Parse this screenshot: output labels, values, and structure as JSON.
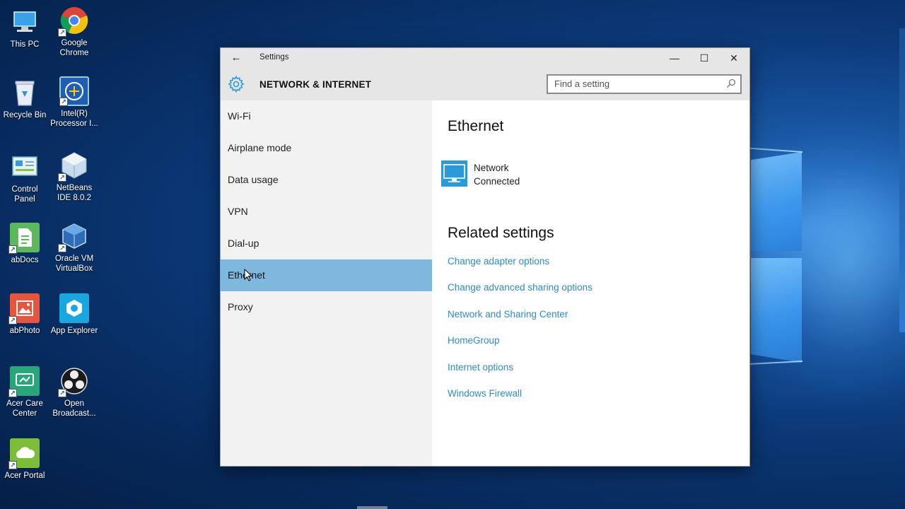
{
  "desktop": {
    "icons": [
      {
        "label": "This PC",
        "icon": "computer-icon"
      },
      {
        "label": "Google Chrome",
        "icon": "chrome-icon"
      },
      {
        "label": "Recycle Bin",
        "icon": "recycle-bin-icon"
      },
      {
        "label": "Intel(R) Processor I...",
        "icon": "intel-processor-icon"
      },
      {
        "label": "Control Panel",
        "icon": "control-panel-icon"
      },
      {
        "label": "NetBeans IDE 8.0.2",
        "icon": "netbeans-icon"
      },
      {
        "label": "abDocs",
        "icon": "abdocs-icon"
      },
      {
        "label": "Oracle VM VirtualBox",
        "icon": "virtualbox-icon"
      },
      {
        "label": "abPhoto",
        "icon": "abphoto-icon"
      },
      {
        "label": "App Explorer",
        "icon": "app-explorer-icon"
      },
      {
        "label": "Acer Care Center",
        "icon": "acer-care-icon"
      },
      {
        "label": "Open Broadcast...",
        "icon": "obs-icon"
      },
      {
        "label": "Acer Portal",
        "icon": "acer-portal-icon"
      }
    ]
  },
  "window": {
    "title": "Settings",
    "back_glyph": "←",
    "minimize_glyph": "—",
    "maximize_glyph": "☐",
    "close_glyph": "✕"
  },
  "header": {
    "section": "NETWORK & INTERNET",
    "search_placeholder": "Find a setting"
  },
  "sidebar": {
    "items": [
      {
        "label": "Wi-Fi"
      },
      {
        "label": "Airplane mode"
      },
      {
        "label": "Data usage"
      },
      {
        "label": "VPN"
      },
      {
        "label": "Dial-up"
      },
      {
        "label": "Ethernet",
        "active": true
      },
      {
        "label": "Proxy"
      }
    ]
  },
  "content": {
    "title": "Ethernet",
    "network": {
      "name": "Network",
      "status": "Connected"
    },
    "related_title": "Related settings",
    "links": [
      "Change adapter options",
      "Change advanced sharing options",
      "Network and Sharing Center",
      "HomeGroup",
      "Internet options",
      "Windows Firewall"
    ]
  },
  "colors": {
    "accent": "#2b9ad6",
    "link": "#2e8bc9",
    "active_nav": "#7fb8df",
    "sidebar_bg": "#f2f2f2",
    "header_bg": "#e6e6e6"
  }
}
